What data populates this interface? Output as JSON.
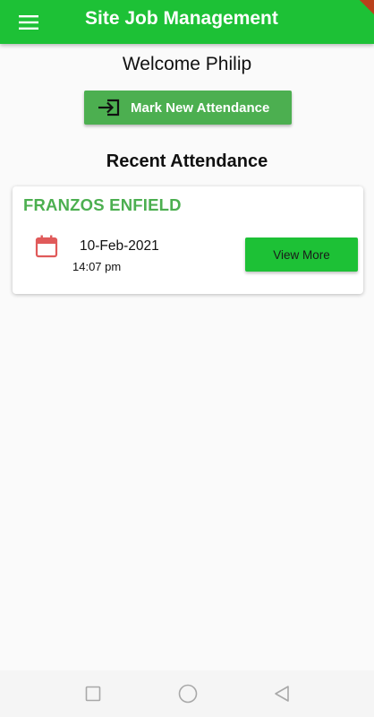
{
  "app_bar": {
    "title": "Site Job Management",
    "color": "#1dc136",
    "menu_icon": "hamburger-menu-icon"
  },
  "welcome": {
    "text": "Welcome Philip"
  },
  "mark_attendance_button": {
    "label": "Mark New Attendance",
    "icon": "login-arrow-icon",
    "color": "#4caf50"
  },
  "recent_section": {
    "title": "Recent Attendance"
  },
  "attendance_records": [
    {
      "name": "FRANZOS ENFIELD",
      "date": "10-Feb-2021",
      "time": "14:07 pm",
      "icon": "calendar-icon",
      "button_label": "View More"
    }
  ],
  "system_nav": {
    "recents_icon": "square-recents-icon",
    "home_icon": "circle-home-icon",
    "back_icon": "triangle-back-icon"
  },
  "colors": {
    "primary": "#1dc136",
    "accent_green": "#4caf50",
    "calendar_red": "#e05a5a"
  }
}
